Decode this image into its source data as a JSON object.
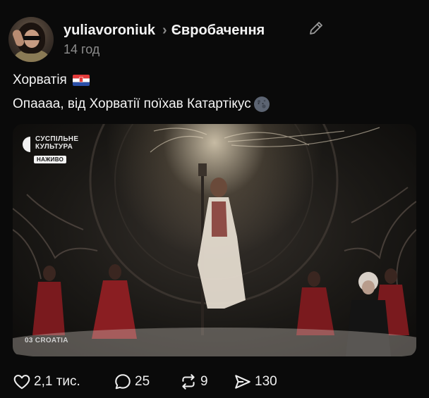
{
  "post": {
    "author": {
      "username": "yuliavoroniuk",
      "avatar_icon": "avatar"
    },
    "breadcrumb_separator": "›",
    "community": "Євробачення",
    "time": "14 год",
    "text_line1": "Хорватія",
    "flag_icon": "croatia-flag-icon",
    "text_line2": "Опаааа, від Хорватії поїхав Катартікус",
    "emoji_icon": "new-moon-face-icon",
    "media": {
      "broadcaster_line1": "СУСПІЛЬНЕ",
      "broadcaster_line2": "КУЛЬТУРА",
      "live_badge": "НАЖИВО",
      "country_caption": "03 CROATIA"
    },
    "actions": {
      "likes": "2,1 тис.",
      "comments": "25",
      "reposts": "9",
      "shares": "130"
    }
  },
  "colors": {
    "background": "#0a0a0a",
    "text": "#f3f3f3",
    "muted": "#8d8d8d",
    "costume_red": "#7a1a1e"
  }
}
